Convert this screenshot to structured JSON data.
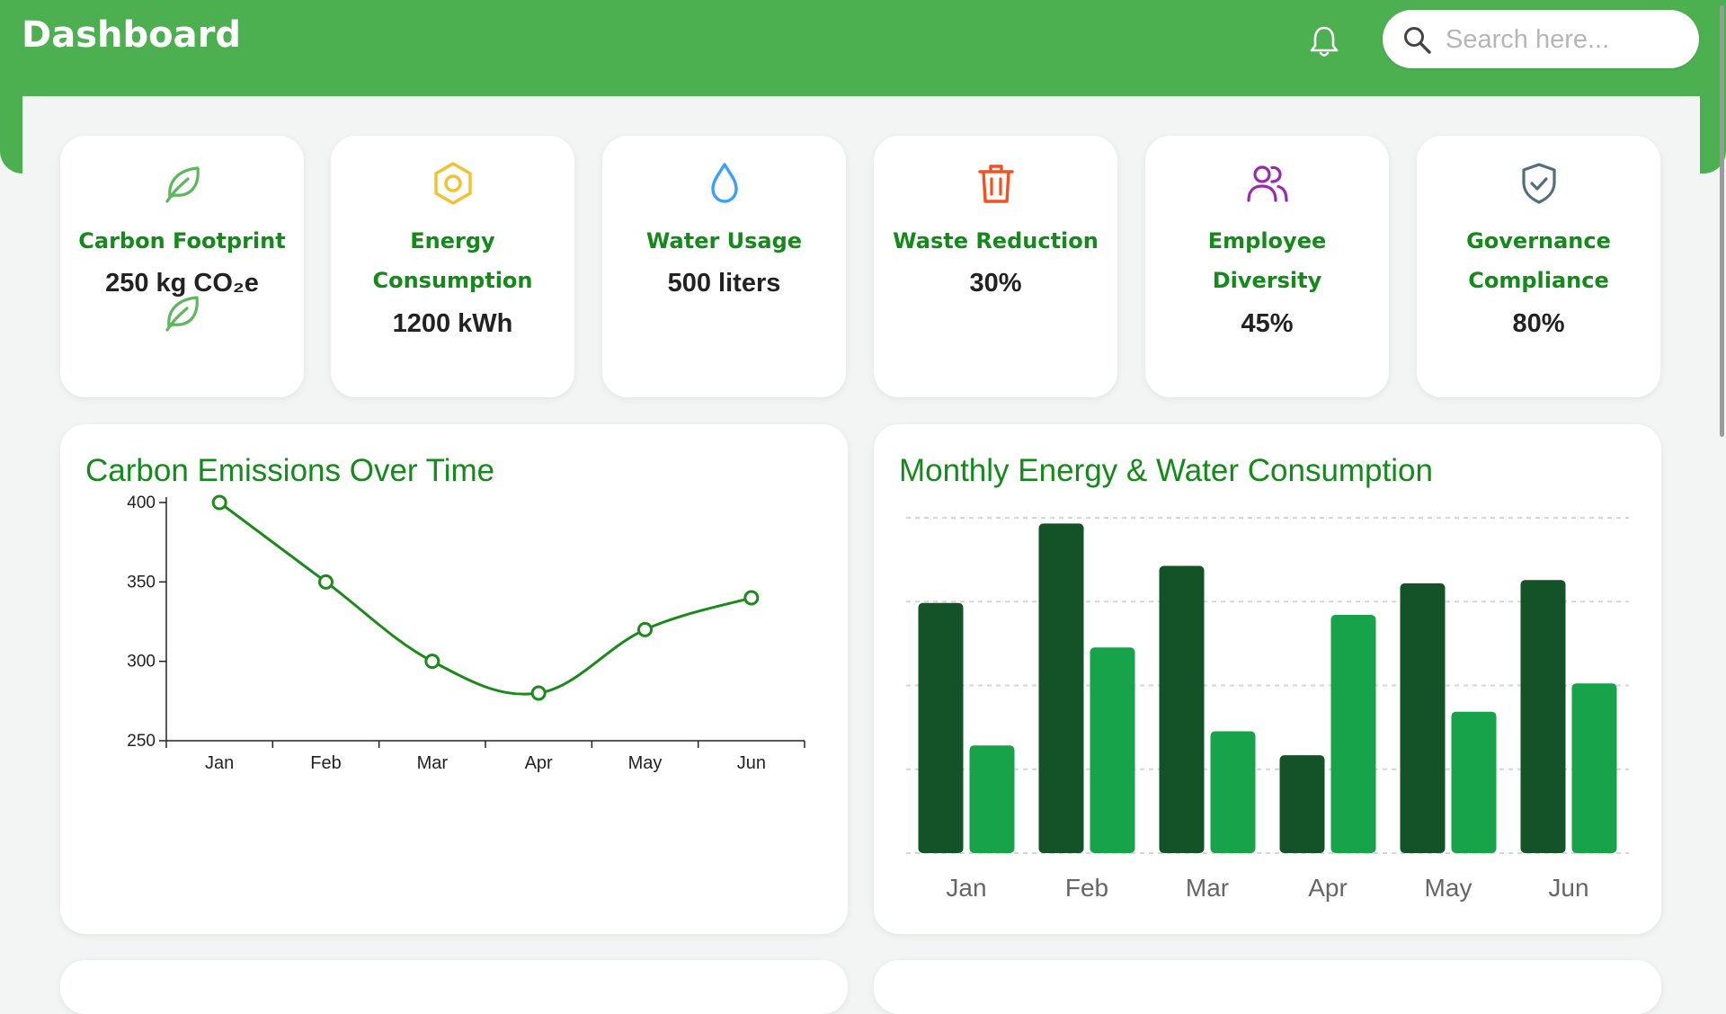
{
  "header": {
    "title": "Dashboard",
    "bell_icon": "bell-icon",
    "search": {
      "placeholder": "Search here...",
      "value": "",
      "icon": "search-icon"
    }
  },
  "colors": {
    "brand": "#4caf50",
    "accent_text": "#138a1a",
    "dark_green": "#145228",
    "light_green": "#17a34a"
  },
  "metrics": [
    {
      "title": "Carbon Footprint",
      "value": "250 kg CO₂e",
      "icon": "leaf-icon",
      "color": "#5cb85c"
    },
    {
      "title": "Energy Consumption",
      "value": "1200 kWh",
      "icon": "hexagon-icon",
      "color": "#f2c12e"
    },
    {
      "title": "Water Usage",
      "value": "500 liters",
      "icon": "water-drop-icon",
      "color": "#3aa0ff"
    },
    {
      "title": "Waste Reduction",
      "value": "30%",
      "icon": "trash-icon",
      "color": "#f4511e"
    },
    {
      "title": "Employee Diversity",
      "value": "45%",
      "icon": "users-icon",
      "color": "#9c27b0"
    },
    {
      "title": "Governance Compliance",
      "value": "80%",
      "icon": "shield-check-icon",
      "color": "#546e7a"
    }
  ],
  "chart_data": [
    {
      "type": "line",
      "title": "Carbon Emissions Over Time",
      "x": [
        "Jan",
        "Feb",
        "Mar",
        "Apr",
        "May",
        "Jun"
      ],
      "values": [
        400,
        350,
        300,
        280,
        320,
        340
      ],
      "ylim": [
        250,
        400
      ],
      "yticks": [
        250,
        300,
        350,
        400
      ],
      "grid": false,
      "color": "#1a8a1a"
    },
    {
      "type": "bar",
      "title": "Monthly Energy & Water Consumption",
      "categories": [
        "Jan",
        "Feb",
        "Mar",
        "Apr",
        "May",
        "Jun"
      ],
      "series": [
        {
          "values": [
            1150,
            1515,
            1320,
            450,
            1240,
            1255
          ],
          "color": "#145228"
        },
        {
          "values": [
            495,
            945,
            560,
            1095,
            650,
            780
          ],
          "color": "#17a34a"
        }
      ],
      "ylim": [
        0,
        1500
      ],
      "grid": true
    }
  ]
}
